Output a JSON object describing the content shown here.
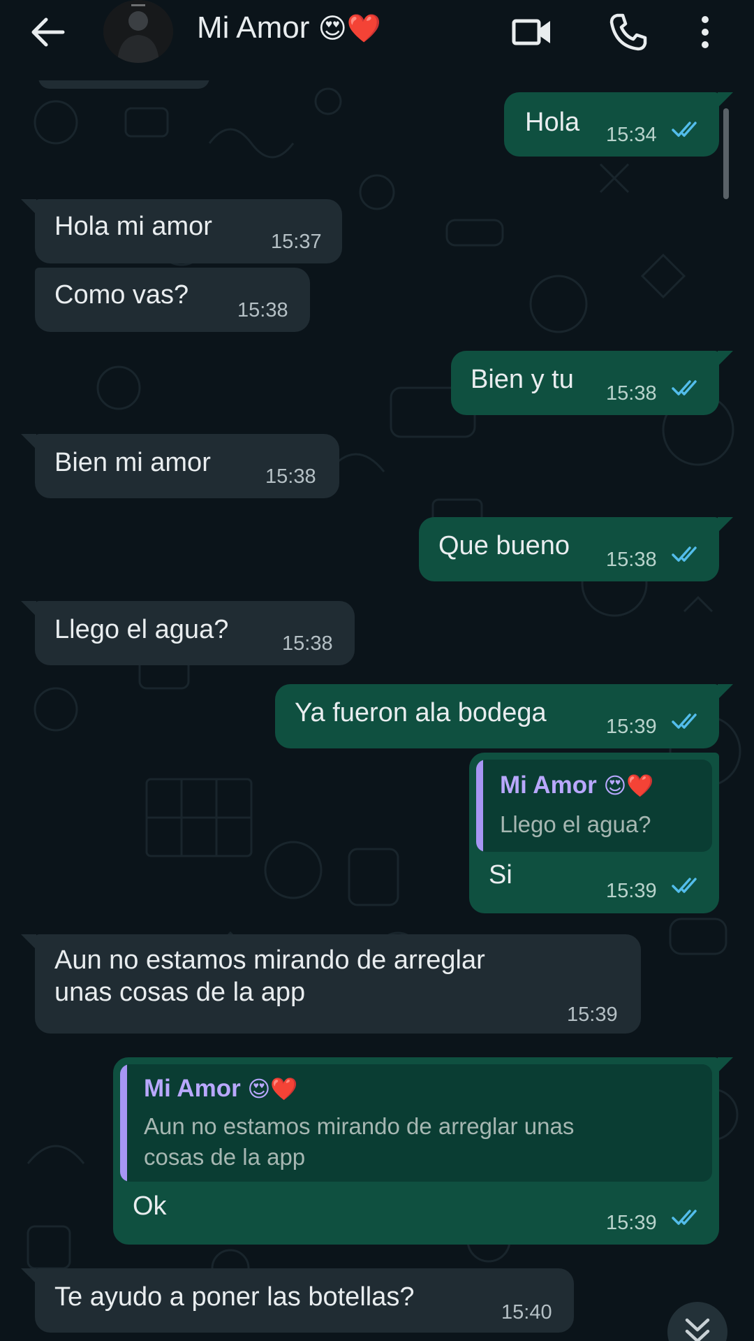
{
  "header": {
    "contact_name": "Mi Amor",
    "contact_emojis": "😍❤️"
  },
  "messages": [
    {
      "dir": "out",
      "text": "Hola",
      "time": "15:34"
    },
    {
      "dir": "in",
      "text": "Hola mi amor",
      "time": "15:37"
    },
    {
      "dir": "in",
      "text": "Como vas?",
      "time": "15:38"
    },
    {
      "dir": "out",
      "text": "Bien y tu",
      "time": "15:38"
    },
    {
      "dir": "in",
      "text": "Bien mi amor",
      "time": "15:38"
    },
    {
      "dir": "out",
      "text": "Que bueno",
      "time": "15:38"
    },
    {
      "dir": "in",
      "text": "Llego el agua?",
      "time": "15:38"
    },
    {
      "dir": "out",
      "text": "Ya fueron ala bodega",
      "time": "15:39"
    },
    {
      "dir": "out",
      "text": "Si",
      "time": "15:39",
      "reply": {
        "name": "Mi Amor",
        "emojis": "😍❤️",
        "text": "Llego el agua?"
      }
    },
    {
      "dir": "in",
      "text": "Aun no estamos mirando de arreglar",
      "text2": "unas cosas de la app",
      "time": "15:39"
    },
    {
      "dir": "out",
      "text": "Ok",
      "time": "15:39",
      "reply": {
        "name": "Mi Amor",
        "emojis": "😍❤️",
        "text": "Aun no estamos mirando de arreglar unas",
        "text2": "cosas de la app"
      }
    },
    {
      "dir": "in",
      "text": "Te ayudo a poner las botellas?",
      "time": "15:40"
    }
  ],
  "colors": {
    "background": "#0b141a",
    "incoming_bubble": "#202c33",
    "outgoing_bubble": "#0f5040",
    "read_ticks": "#53bdeb",
    "quote_accent": "#a796f4"
  },
  "icons": [
    "back-arrow-icon",
    "avatar",
    "video-call-icon",
    "phone-icon",
    "more-vert-icon",
    "double-check-icon",
    "chevron-down-icon"
  ]
}
